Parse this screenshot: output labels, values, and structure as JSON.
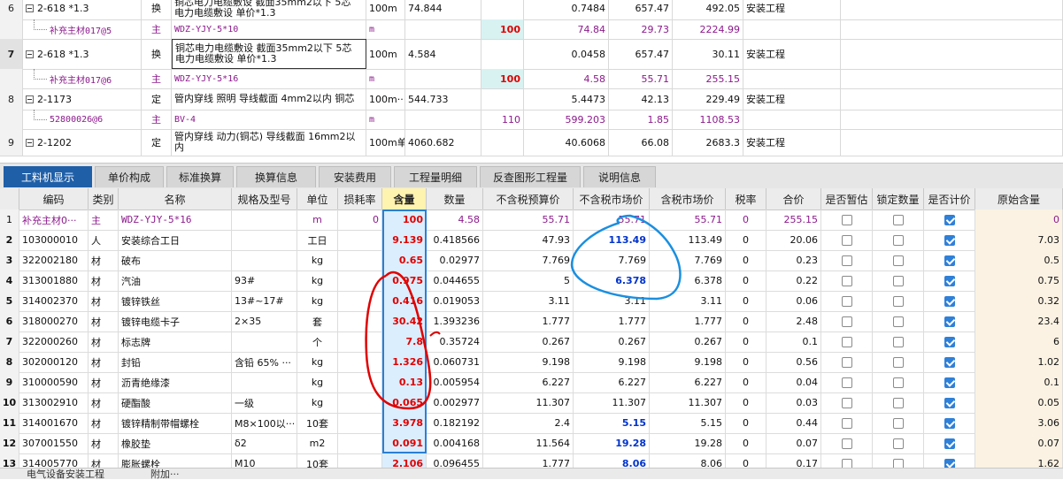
{
  "top_rows": [
    {
      "rn": "6",
      "code": "2-618 *1.3",
      "type": "换",
      "name": "铜芯电力电缆敷设 截面35mm2以下 5芯 电力电缆敷设 单价*1.3",
      "unit": "100m",
      "qty": "74.844",
      "v1": "",
      "v2": "0.7484",
      "v3": "657.47",
      "v4": "492.05",
      "cat": "安装工程",
      "kind": "main"
    },
    {
      "rn": "",
      "code": "补充主材017@5",
      "type": "主",
      "name": "WDZ-YJY-5*10",
      "unit": "m",
      "qty": "",
      "v1": "100",
      "v2": "74.84",
      "v3": "29.73",
      "v4": "2224.99",
      "cat": "",
      "kind": "sub"
    },
    {
      "rn": "7",
      "code": "2-618 *1.3",
      "type": "换",
      "name": "铜芯电力电缆敷设 截面35mm2以下 5芯 电力电缆敷设 单价*1.3",
      "unit": "100m",
      "qty": "4.584",
      "v1": "",
      "v2": "0.0458",
      "v3": "657.47",
      "v4": "30.11",
      "cat": "安装工程",
      "kind": "main"
    },
    {
      "rn": "",
      "code": "补充主材017@6",
      "type": "主",
      "name": "WDZ-YJY-5*16",
      "unit": "m",
      "qty": "",
      "v1": "100",
      "v2": "4.58",
      "v3": "55.71",
      "v4": "255.15",
      "cat": "",
      "kind": "sub"
    },
    {
      "rn": "8",
      "code": "2-1173",
      "type": "定",
      "name": "管内穿线 照明 导线截面 4mm2以内 铜芯",
      "unit": "100m···",
      "qty": "544.733",
      "v1": "",
      "v2": "5.4473",
      "v3": "42.13",
      "v4": "229.49",
      "cat": "安装工程",
      "kind": "main"
    },
    {
      "rn": "",
      "code": "52800026@6",
      "type": "主",
      "name": "BV-4",
      "unit": "m",
      "qty": "",
      "v1": "110",
      "v2": "599.203",
      "v3": "1.85",
      "v4": "1108.53",
      "cat": "",
      "kind": "sub"
    },
    {
      "rn": "9",
      "code": "2-1202",
      "type": "定",
      "name": "管内穿线 动力(铜芯) 导线截面 16mm2以内",
      "unit": "100m单线",
      "qty": "4060.682",
      "v1": "",
      "v2": "40.6068",
      "v3": "66.08",
      "v4": "2683.3",
      "cat": "安装工程",
      "kind": "main"
    }
  ],
  "tabs": [
    "工料机显示",
    "单价构成",
    "标准换算",
    "换算信息",
    "安装费用",
    "工程量明细",
    "反查图形工程量",
    "说明信息"
  ],
  "headers": [
    "编码",
    "类别",
    "名称",
    "规格及型号",
    "单位",
    "损耗率",
    "含量",
    "数量",
    "不含税预算价",
    "不含税市场价",
    "含税市场价",
    "税率",
    "合价",
    "是否暂估",
    "锁定数量",
    "是否计价",
    "原始含量"
  ],
  "rows": [
    {
      "n": "1",
      "code": "补充主材0···",
      "cat": "主",
      "name": "WDZ-YJY-5*16",
      "spec": "",
      "unit": "m",
      "loss": "0",
      "qty": "100",
      "num": "4.58",
      "pre": "55.71",
      "mkt": "55.71",
      "mkt_tax": "55.71",
      "tax": "0",
      "total": "255.15",
      "est": false,
      "lock": false,
      "price": true,
      "orig": "0"
    },
    {
      "n": "2",
      "code": "103000010",
      "cat": "人",
      "name": "安装综合工日",
      "spec": "",
      "unit": "工日",
      "loss": "",
      "qty": "9.139",
      "num": "0.418566",
      "pre": "47.93",
      "mkt": "113.49",
      "mkt_tax": "113.49",
      "tax": "0",
      "total": "20.06",
      "est": false,
      "lock": false,
      "price": true,
      "orig": "7.03"
    },
    {
      "n": "3",
      "code": "322002180",
      "cat": "材",
      "name": "破布",
      "spec": "",
      "unit": "kg",
      "loss": "",
      "qty": "0.65",
      "num": "0.02977",
      "pre": "7.769",
      "mkt": "7.769",
      "mkt_tax": "7.769",
      "tax": "0",
      "total": "0.23",
      "est": false,
      "lock": false,
      "price": true,
      "orig": "0.5"
    },
    {
      "n": "4",
      "code": "313001880",
      "cat": "材",
      "name": "汽油",
      "spec": "93#",
      "unit": "kg",
      "loss": "",
      "qty": "0.975",
      "num": "0.044655",
      "pre": "5",
      "mkt": "6.378",
      "mkt_tax": "6.378",
      "tax": "0",
      "total": "0.22",
      "est": false,
      "lock": false,
      "price": true,
      "orig": "0.75"
    },
    {
      "n": "5",
      "code": "314002370",
      "cat": "材",
      "name": "镀锌铁丝",
      "spec": "13#~17#",
      "unit": "kg",
      "loss": "",
      "qty": "0.416",
      "num": "0.019053",
      "pre": "3.11",
      "mkt": "3.11",
      "mkt_tax": "3.11",
      "tax": "0",
      "total": "0.06",
      "est": false,
      "lock": false,
      "price": true,
      "orig": "0.32"
    },
    {
      "n": "6",
      "code": "318000270",
      "cat": "材",
      "name": "镀锌电缆卡子",
      "spec": "2×35",
      "unit": "套",
      "loss": "",
      "qty": "30.42",
      "num": "1.393236",
      "pre": "1.777",
      "mkt": "1.777",
      "mkt_tax": "1.777",
      "tax": "0",
      "total": "2.48",
      "est": false,
      "lock": false,
      "price": true,
      "orig": "23.4"
    },
    {
      "n": "7",
      "code": "322000260",
      "cat": "材",
      "name": "标志牌",
      "spec": "",
      "unit": "个",
      "loss": "",
      "qty": "7.8",
      "num": "0.35724",
      "pre": "0.267",
      "mkt": "0.267",
      "mkt_tax": "0.267",
      "tax": "0",
      "total": "0.1",
      "est": false,
      "lock": false,
      "price": true,
      "orig": "6"
    },
    {
      "n": "8",
      "code": "302000120",
      "cat": "材",
      "name": "封铅",
      "spec": "含铅 65% ···",
      "unit": "kg",
      "loss": "",
      "qty": "1.326",
      "num": "0.060731",
      "pre": "9.198",
      "mkt": "9.198",
      "mkt_tax": "9.198",
      "tax": "0",
      "total": "0.56",
      "est": false,
      "lock": false,
      "price": true,
      "orig": "1.02"
    },
    {
      "n": "9",
      "code": "310000590",
      "cat": "材",
      "name": "沥青绝缘漆",
      "spec": "",
      "unit": "kg",
      "loss": "",
      "qty": "0.13",
      "num": "0.005954",
      "pre": "6.227",
      "mkt": "6.227",
      "mkt_tax": "6.227",
      "tax": "0",
      "total": "0.04",
      "est": false,
      "lock": false,
      "price": true,
      "orig": "0.1"
    },
    {
      "n": "10",
      "code": "313002910",
      "cat": "材",
      "name": "硬酯酸",
      "spec": "一级",
      "unit": "kg",
      "loss": "",
      "qty": "0.065",
      "num": "0.002977",
      "pre": "11.307",
      "mkt": "11.307",
      "mkt_tax": "11.307",
      "tax": "0",
      "total": "0.03",
      "est": false,
      "lock": false,
      "price": true,
      "orig": "0.05"
    },
    {
      "n": "11",
      "code": "314001670",
      "cat": "材",
      "name": "镀锌精制带帽螺栓",
      "spec": "M8×100以···",
      "unit": "10套",
      "loss": "",
      "qty": "3.978",
      "num": "0.182192",
      "pre": "2.4",
      "mkt": "5.15",
      "mkt_tax": "5.15",
      "tax": "0",
      "total": "0.44",
      "est": false,
      "lock": false,
      "price": true,
      "orig": "3.06"
    },
    {
      "n": "12",
      "code": "307001550",
      "cat": "材",
      "name": "橡胶垫",
      "spec": "δ2",
      "unit": "m2",
      "loss": "",
      "qty": "0.091",
      "num": "0.004168",
      "pre": "11.564",
      "mkt": "19.28",
      "mkt_tax": "19.28",
      "tax": "0",
      "total": "0.07",
      "est": false,
      "lock": false,
      "price": true,
      "orig": "0.07"
    },
    {
      "n": "13",
      "code": "314005770",
      "cat": "材",
      "name": "膨胀螺栓",
      "spec": "M10",
      "unit": "10套",
      "loss": "",
      "qty": "2.106",
      "num": "0.096455",
      "pre": "1.777",
      "mkt": "8.06",
      "mkt_tax": "8.06",
      "tax": "0",
      "total": "0.17",
      "est": false,
      "lock": false,
      "price": true,
      "orig": "1.62"
    }
  ],
  "bold_blue_mkt_rows": [
    1,
    3,
    10,
    11,
    12
  ],
  "status_tabs": [
    "电气设备安装工程",
    "附加···"
  ],
  "colors": {
    "active_tab": "#1f5fa8",
    "qty_header": "#fff3b0",
    "qty_col": "#dbeefd",
    "annotation_red": "#e00000",
    "annotation_blue": "#1a8fe0"
  }
}
